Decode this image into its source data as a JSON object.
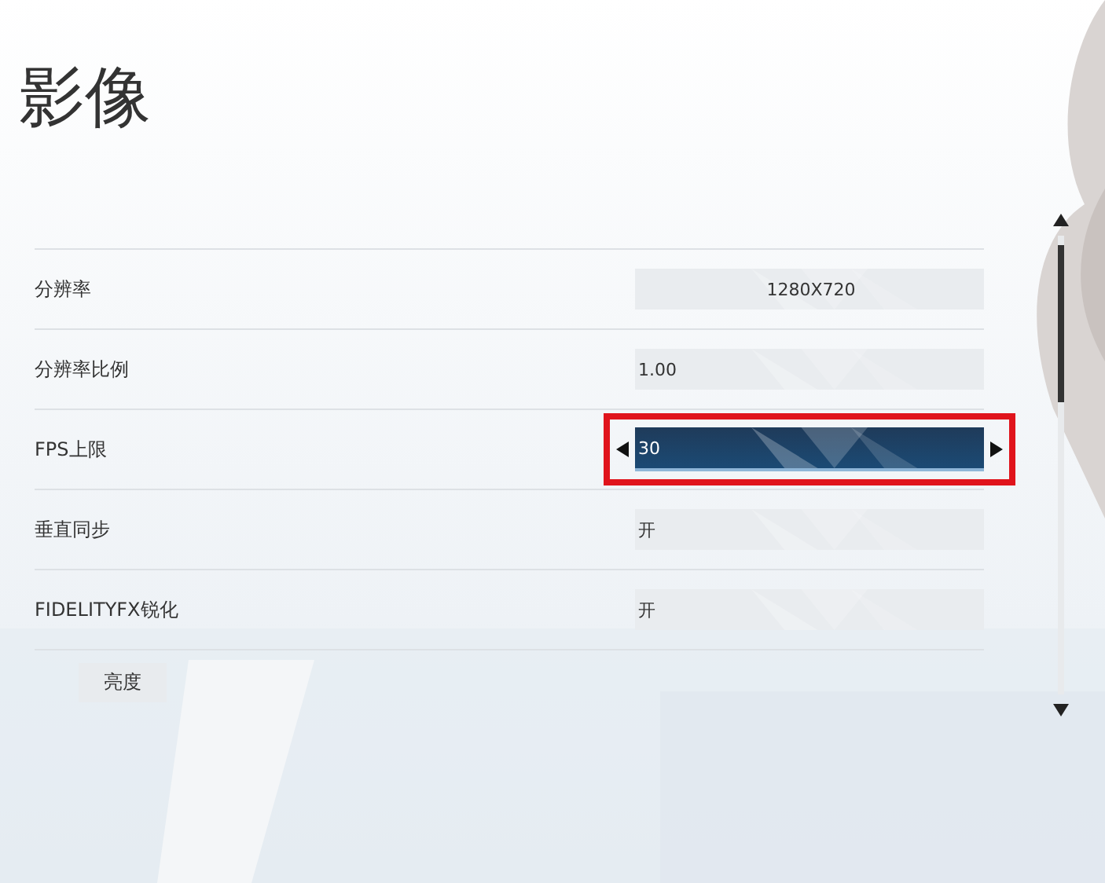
{
  "title": "影像",
  "settings": [
    {
      "label": "分辨率",
      "kind": "dropdown",
      "value": "1280X720",
      "selected": false,
      "highlighted": false
    },
    {
      "label": "分辨率比例",
      "kind": "selector",
      "value": "1.00",
      "selected": false,
      "highlighted": false
    },
    {
      "label": "FPS上限",
      "kind": "selector",
      "value": "30",
      "selected": true,
      "highlighted": true
    },
    {
      "label": "垂直同步",
      "kind": "selector",
      "value": "开",
      "selected": false,
      "highlighted": false
    },
    {
      "label": "FIDELITYFX锐化",
      "kind": "selector",
      "value": "开",
      "selected": false,
      "highlighted": false
    }
  ],
  "section": {
    "label": "亮度"
  }
}
